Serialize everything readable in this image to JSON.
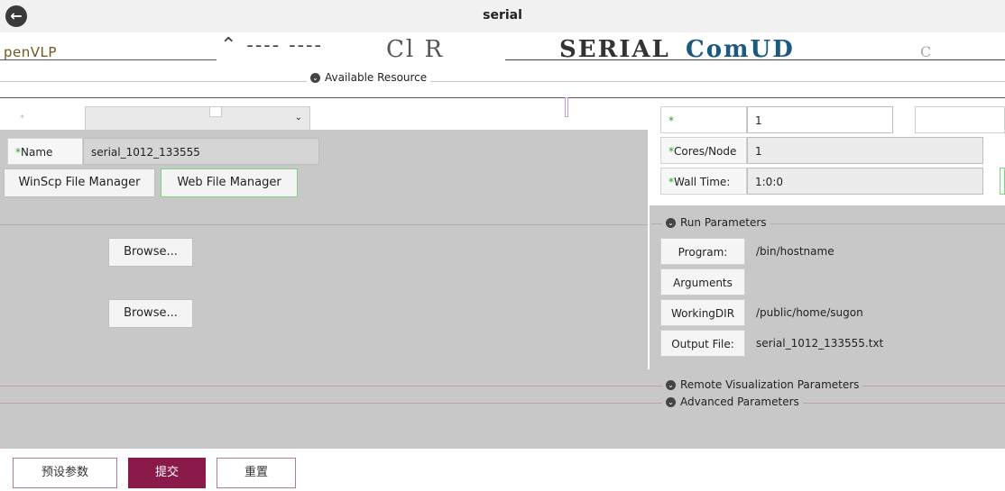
{
  "window": {
    "title": "serial"
  },
  "banner": {
    "logo": "penVLP",
    "ghost1": "⌃ ---- ----",
    "ghost2": "Cl R",
    "ghost3": "SERIAL",
    "ghost4": "ComUD",
    "ghost5": "C"
  },
  "sections": {
    "available_resource": "Available Resource",
    "run_parameters": "Run Parameters",
    "remote_visualization": "Remote Visualization Parameters",
    "advanced": "Advanced Parameters"
  },
  "job": {
    "name_label": "Name",
    "name_value": "serial_1012_133555",
    "nodes_value": "1",
    "cores_label": "Cores/Node",
    "cores_value": "1",
    "walltime_label": "Wall Time:",
    "walltime_value": "1:0:0"
  },
  "buttons": {
    "winscp": "WinScp File Manager",
    "web_fm": "Web File Manager",
    "browse1": "Browse...",
    "browse2": "Browse..."
  },
  "run": {
    "program_label": "Program:",
    "program_value": "/bin/hostname",
    "arguments_label": "Arguments",
    "arguments_value": "",
    "workdir_label": "WorkingDIR",
    "workdir_value": "/public/home/sugon",
    "output_label": "Output File:",
    "output_value": "serial_1012_133555.txt"
  },
  "footer": {
    "preset": "预设参数",
    "submit": "提交",
    "reset": "重置"
  },
  "colors": {
    "accent": "#8a1a4a",
    "required": "#27a327",
    "panel": "#c8c8c8"
  }
}
